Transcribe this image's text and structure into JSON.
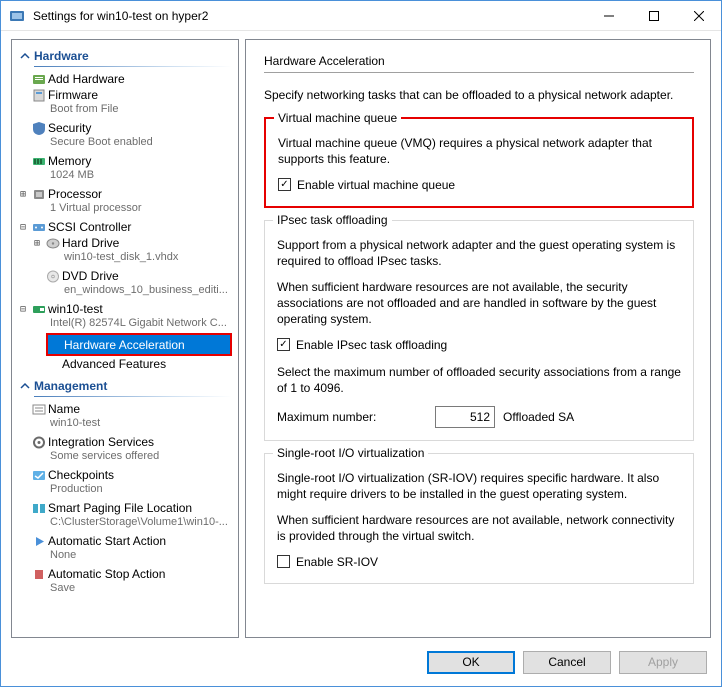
{
  "window": {
    "title": "Settings for win10-test on hyper2"
  },
  "sections": {
    "hardware": "Hardware",
    "management": "Management"
  },
  "tree": {
    "addHardware": "Add Hardware",
    "firmware": "Firmware",
    "firmwareSub": "Boot from File",
    "security": "Security",
    "securitySub": "Secure Boot enabled",
    "memory": "Memory",
    "memorySub": "1024 MB",
    "processor": "Processor",
    "processorSub": "1 Virtual processor",
    "scsi": "SCSI Controller",
    "hardDrive": "Hard Drive",
    "hardDriveSub": "win10-test_disk_1.vhdx",
    "dvd": "DVD Drive",
    "dvdSub": "en_windows_10_business_editi...",
    "nic": "win10-test",
    "nicSub": "Intel(R) 82574L Gigabit Network C...",
    "hwAccel": "Hardware Acceleration",
    "advFeat": "Advanced Features",
    "name": "Name",
    "nameSub": "win10-test",
    "integ": "Integration Services",
    "integSub": "Some services offered",
    "checkpoints": "Checkpoints",
    "checkpointsSub": "Production",
    "paging": "Smart Paging File Location",
    "pagingSub": "C:\\ClusterStorage\\Volume1\\win10-...",
    "autoStart": "Automatic Start Action",
    "autoStartSub": "None",
    "autoStop": "Automatic Stop Action",
    "autoStopSub": "Save"
  },
  "content": {
    "title": "Hardware Acceleration",
    "intro": "Specify networking tasks that can be offloaded to a physical network adapter.",
    "vmq": {
      "legend": "Virtual machine queue",
      "desc": "Virtual machine queue (VMQ) requires a physical network adapter that supports this feature.",
      "chk": "Enable virtual machine queue"
    },
    "ipsec": {
      "legend": "IPsec task offloading",
      "desc1": "Support from a physical network adapter and the guest operating system is required to offload IPsec tasks.",
      "desc2": "When sufficient hardware resources are not available, the security associations are not offloaded and are handled in software by the guest operating system.",
      "chk": "Enable IPsec task offloading",
      "desc3": "Select the maximum number of offloaded security associations from a range of 1 to 4096.",
      "maxLabel": "Maximum number:",
      "maxValue": "512",
      "maxSuffix": "Offloaded SA"
    },
    "sriov": {
      "legend": "Single-root I/O virtualization",
      "desc1": "Single-root I/O virtualization (SR-IOV) requires specific hardware. It also might require drivers to be installed in the guest operating system.",
      "desc2": "When sufficient hardware resources are not available, network connectivity is provided through the virtual switch.",
      "chk": "Enable SR-IOV"
    }
  },
  "buttons": {
    "ok": "OK",
    "cancel": "Cancel",
    "apply": "Apply"
  }
}
